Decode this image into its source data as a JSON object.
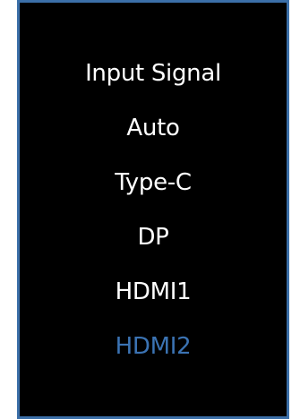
{
  "osd": {
    "title": "Input Signal",
    "options": [
      {
        "label": "Auto",
        "selected": false
      },
      {
        "label": "Type-C",
        "selected": false
      },
      {
        "label": "DP",
        "selected": false
      },
      {
        "label": "HDMI1",
        "selected": false
      },
      {
        "label": "HDMI2",
        "selected": true
      }
    ],
    "colors": {
      "background": "#000000",
      "border": "#3b6fa8",
      "text": "#ffffff",
      "selected_text": "#3b73b3"
    }
  }
}
